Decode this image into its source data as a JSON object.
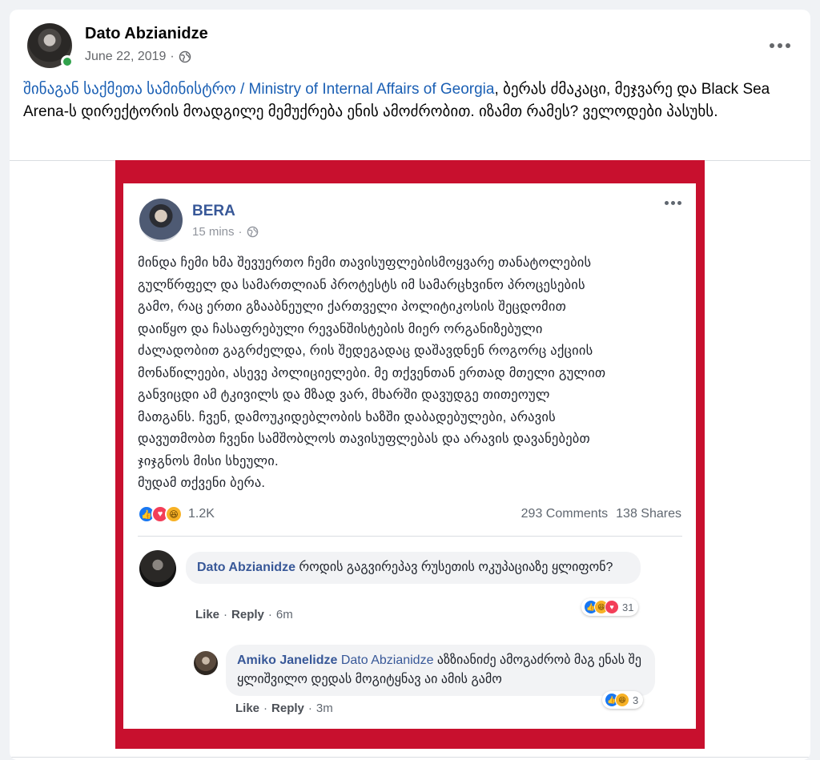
{
  "post": {
    "author": "Dato Abzianidze",
    "date": "June 22, 2019",
    "separator": "·",
    "mention": "შინაგან საქმეთა სამინისტრო / Ministry of Internal Affairs of Georgia",
    "text_rest": ", ბერას ძმაკაცი, მეჯვარე და Black Sea Arena-ს დირექტორის მოადგილე მემუქრება ენის ამოძრობით. იზამთ რამეს? ველოდები პასუხს."
  },
  "embedded": {
    "author": "BERA",
    "time": "15 mins",
    "separator": "·",
    "body": "მინდა ჩემი ხმა შევუერთო ჩემი თავისუფლებისმოყვარე თანატოლების\nგულწრფელ და სამართლიან პროტესტს იმ სამარცხვინო პროცესების\nგამო, რაც ერთი გზააბნეული ქართველი პოლიტიკოსის შეცდომით\nდაიწყო და ჩასაფრებული რევანშისტების მიერ ორგანიზებული\nძალადობით გაგრძელდა, რის შედეგადაც დაშავდნენ როგორც აქციის\nმონაწილეები, ასევე პოლიციელები. მე თქვენთან ერთად მთელი გულით\nგანვიცდი ამ ტკივილს და მზად ვარ, მხარში დავუდგე თითეოულ\nმათგანს. ჩვენ, დამოუკიდებლობის ხაზში დაბადებულები, არავის\nდავუთმობთ ჩვენი სამშობლოს თავისუფლებას და არავის დავანებებთ\nჯიჯგნოს მისი სხეული.\nმუდამ თქვენი ბერა.",
    "reactions_count": "1.2K",
    "comments": "293 Comments",
    "shares": "138 Shares",
    "comment1": {
      "author": "Dato Abzianidze",
      "text": " როდის გაგვირეპავ რუსეთის ოკუპაციაზე ყლიფონ?",
      "like": "Like",
      "reply": "Reply",
      "dot": "·",
      "time": "6m",
      "reactions": "31"
    },
    "comment2": {
      "author": "Amiko Janelidze",
      "tag": "Dato Abzianidze",
      "text": " აზზიანიძე ამოგაძრობ მაგ ენას შე ყლიშვილო დედას მოგიტყნავ აი ამის გამო",
      "like": "Like",
      "reply": "Reply",
      "dot": "·",
      "time": "3m",
      "reactions": "3"
    }
  },
  "icons": {
    "globe": "globe-icon",
    "more": "more-options-icon",
    "like": "like-reaction-icon",
    "love": "love-reaction-icon",
    "haha": "haha-reaction-icon"
  },
  "colors": {
    "link": "#1a5fb4",
    "embed_border": "#c8102e",
    "name_blue": "#385898",
    "online": "#31a24c"
  }
}
